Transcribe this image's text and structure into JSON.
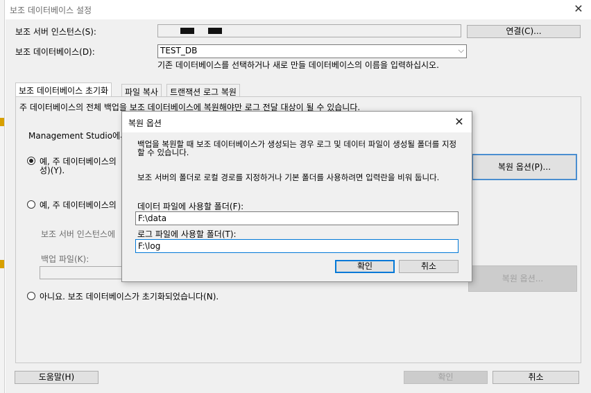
{
  "window": {
    "title": "보조 데이터베이스 설정"
  },
  "server": {
    "label": "보조 서버 인스턴스(S):",
    "connect_button": "연결(C)..."
  },
  "database": {
    "label": "보조 데이터베이스(D):",
    "value": "TEST_DB",
    "hint": "기존 데이터베이스를 선택하거나 새로 만들 데이터베이스의 이름을 입력하십시오."
  },
  "tabs": [
    {
      "label": "보조 데이터베이스 초기화"
    },
    {
      "label": "파일 복사"
    },
    {
      "label": "트랜잭션 로그 복원"
    }
  ],
  "panel": {
    "intro": "주 데이터베이스의 전체 백업을 보조 데이터베이스에 복원해야만 로그 전달 대상이 될 수 있습니다.",
    "ms_text": "Management Studio에서",
    "option1_line1": "예, 주 데이터베이스의",
    "option1_line2": "성)(Y).",
    "option2": "예, 주 데이터베이스의",
    "server_instance_label": "보조 서버 인스턴스에",
    "backup_file_label": "백업 파일(K):",
    "restore_options_button": "복원 옵션(P)...",
    "restore_options_button_disabled": "복원 옵션...",
    "option3": "아니요. 보조 데이터베이스가 초기화되었습니다(N)."
  },
  "footer": {
    "help_button": "도움말(H)",
    "ok_button": "확인",
    "cancel_button": "취소"
  },
  "dialog": {
    "title": "복원 옵션",
    "para1": "백업을 복원할 때 보조 데이터베이스가 생성되는 경우 로그 및 데이터 파일이 생성될 폴더를 지정할 수 있습니다.",
    "para2": "보조 서버의 폴더로 로컬 경로를 지정하거나 기본 폴더를 사용하려면 입력란을 비워 둡니다.",
    "data_folder_label": "데이터 파일에 사용할 폴더(F):",
    "data_folder_value": "F:\\data",
    "log_folder_label": "로그 파일에 사용할 폴더(T):",
    "log_folder_value": "F:\\log",
    "ok_button": "확인",
    "cancel_button": "취소"
  },
  "colors": {
    "accent": "#0078d7",
    "window_bg": "#f0f0f0"
  }
}
